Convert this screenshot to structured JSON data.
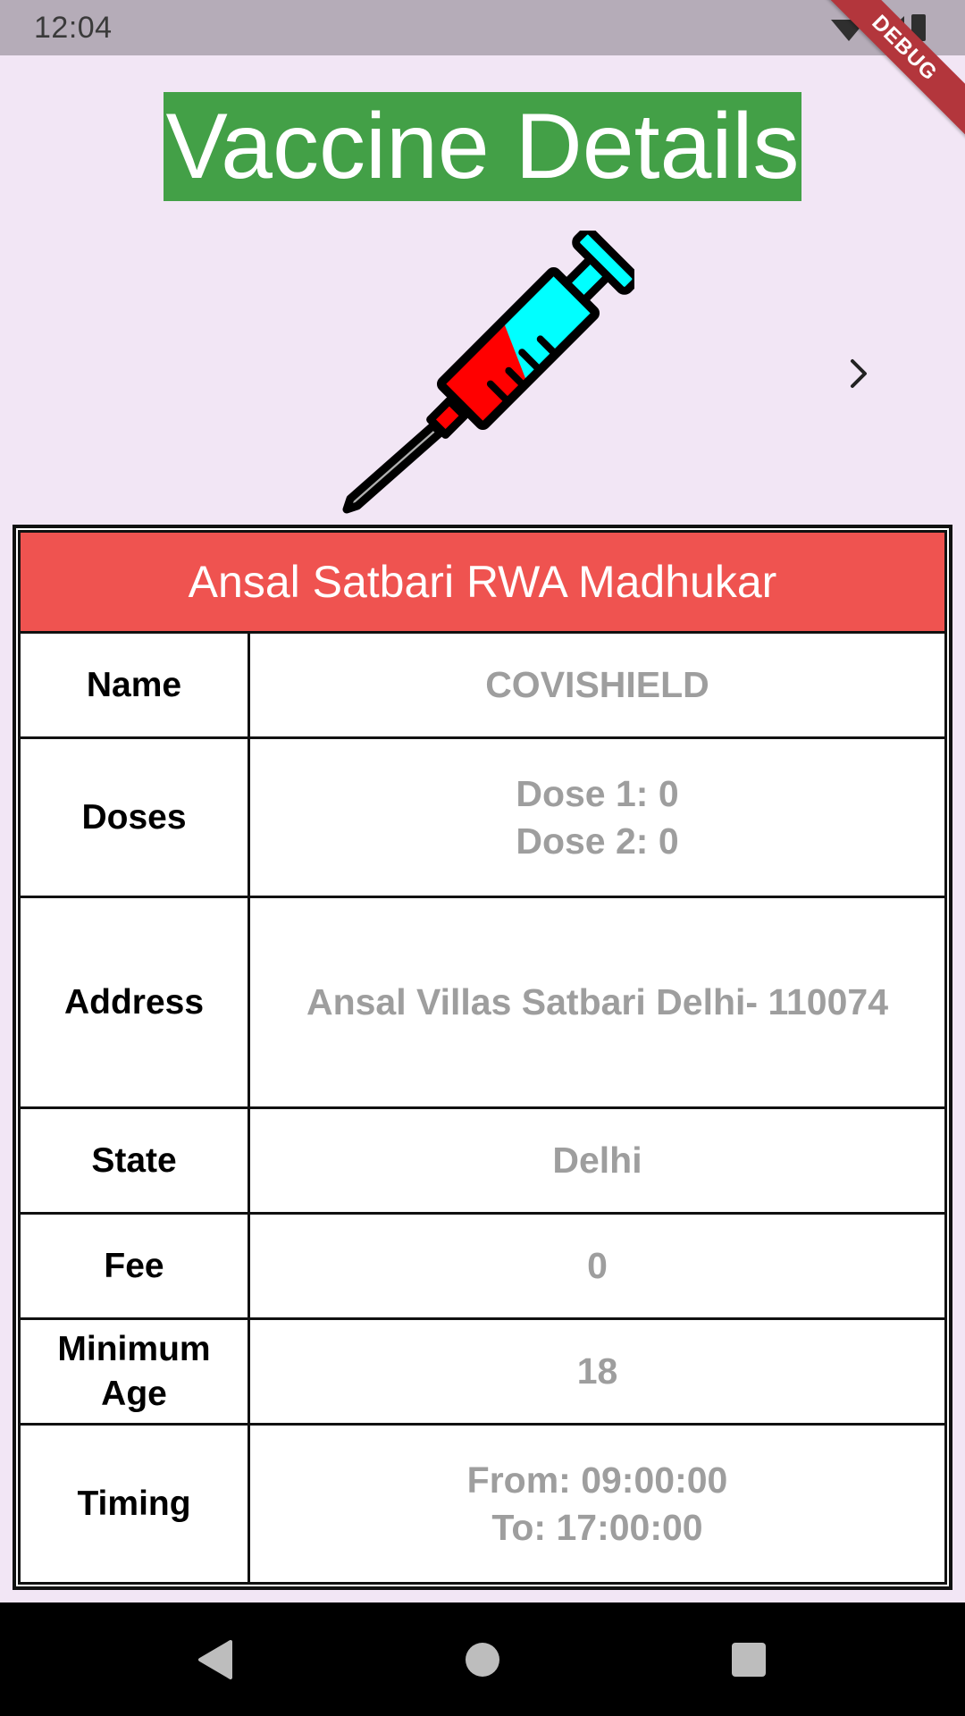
{
  "status_bar": {
    "time": "12:04",
    "icons": [
      "wifi-icon",
      "signal-icon",
      "battery-icon"
    ],
    "debug_label": "DEBUG"
  },
  "header": {
    "title": "Vaccine Details",
    "title_bg": "#43a047"
  },
  "illustration": "syringe-icon",
  "navigation": {
    "next_icon": "chevron-right-icon"
  },
  "center": {
    "name": "Ansal Satbari RWA Madhukar",
    "header_bg": "#ef5350"
  },
  "details": {
    "name_label": "Name",
    "name_value": "COVISHIELD",
    "doses_label": "Doses",
    "dose1": "Dose 1: 0",
    "dose2": "Dose 2: 0",
    "address_label": "Address",
    "address_value": "Ansal Villas Satbari Delhi- 110074",
    "state_label": "State",
    "state_value": "Delhi",
    "fee_label": "Fee",
    "fee_value": "0",
    "min_age_label_1": "Minimum",
    "min_age_label_2": "Age",
    "min_age_value": "18",
    "timing_label": "Timing",
    "timing_from": "From: 09:00:00",
    "timing_to": "To: 17:00:00"
  },
  "system_nav": [
    "back-icon",
    "home-icon",
    "recents-icon"
  ]
}
